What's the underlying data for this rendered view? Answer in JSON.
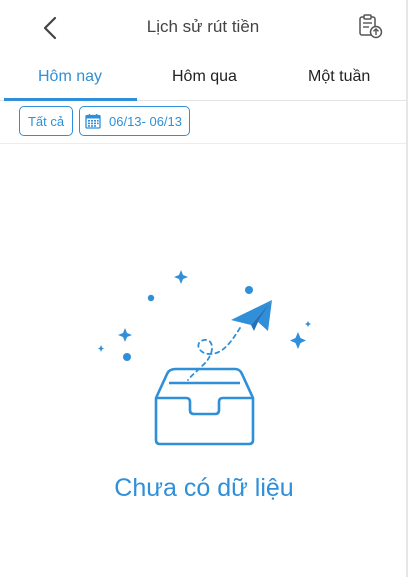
{
  "header": {
    "title": "Lịch sử rút tiền",
    "back_icon": "chevron-left-icon",
    "history_icon": "clipboard-upload-icon"
  },
  "tabs": [
    {
      "label": "Hôm nay",
      "active": true
    },
    {
      "label": "Hôm qua",
      "active": false
    },
    {
      "label": "Một tuần",
      "active": false
    }
  ],
  "filters": {
    "all_label": "Tất cả",
    "date_range": "06/13- 06/13",
    "calendar_icon": "calendar-icon"
  },
  "empty_state": {
    "message": "Chưa có dữ liệu",
    "illustration": "empty-inbox-paper-plane-icon"
  },
  "colors": {
    "accent": "#2f8fd8",
    "title_text": "#444444",
    "body_text": "#222222"
  }
}
